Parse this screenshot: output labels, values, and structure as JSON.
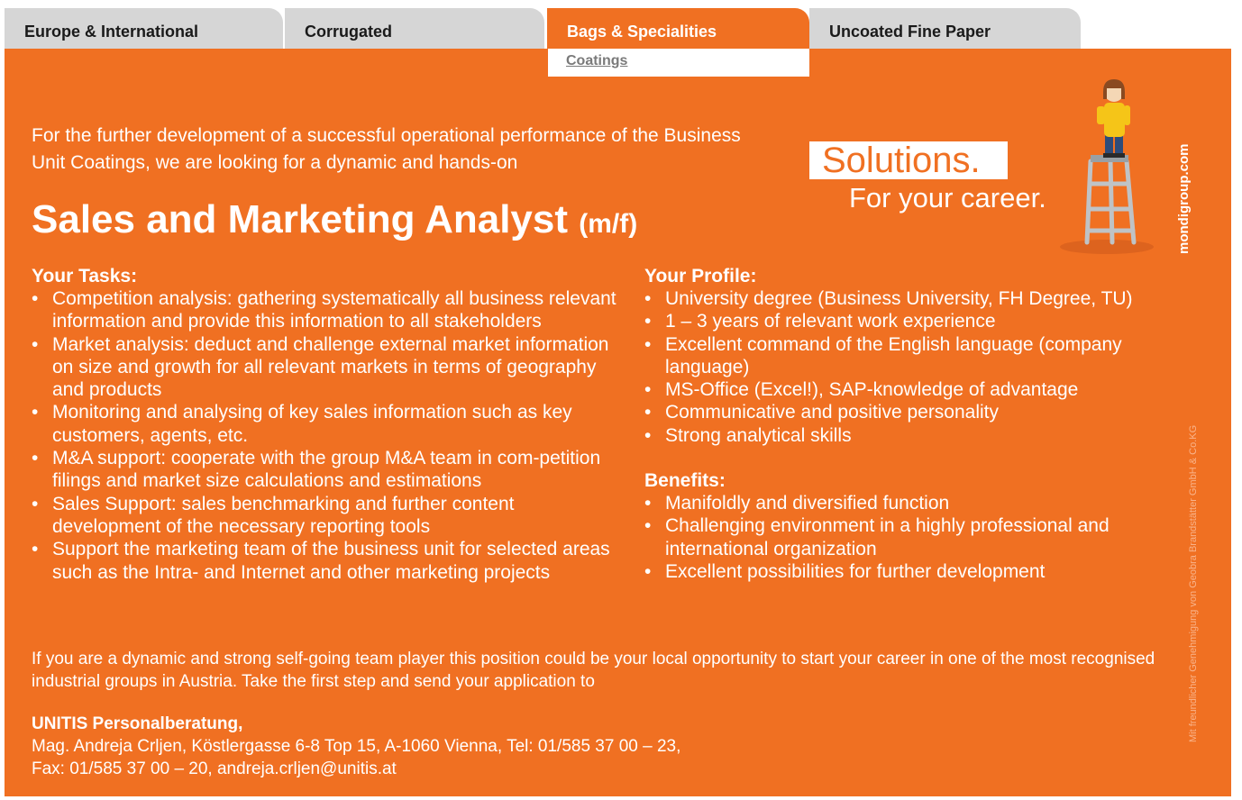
{
  "nav": {
    "tabs": [
      {
        "label": "Europe & International",
        "active": false
      },
      {
        "label": "Corrugated",
        "active": false
      },
      {
        "label": "Bags & Specialities",
        "active": true
      },
      {
        "label": "Uncoated Fine Paper",
        "active": false
      }
    ],
    "subnav": {
      "label": "Coatings"
    }
  },
  "colors": {
    "brand_orange": "#f07022",
    "tab_grey": "#d6d6d6",
    "text_white": "#ffffff"
  },
  "ad": {
    "intro": "For the further development of a successful operational performance of the Business Unit Coatings, we are looking for a dynamic and hands-on",
    "title": "Sales and Marketing Analyst",
    "title_suffix": "(m/f)",
    "brand_word": "Solutions.",
    "tagline": "For your career.",
    "site": "mondigroup.com",
    "photo_credit": "Mit freundlicher Genehmigung von Geobra Brandstätter GmbH & Co.KG",
    "figure_icon": "playmobil-figure-on-ladder-icon",
    "tasks_heading": "Your Tasks:",
    "tasks": [
      "Competition analysis: gathering systematically all business relevant information and provide this information to all stakeholders",
      "Market analysis: deduct and challenge external market information on size and growth for all relevant markets in terms of geography and products",
      "Monitoring and analysing of key sales information such as key customers, agents, etc.",
      "M&A support: cooperate with the group M&A team in com-petition filings and market size calculations and estimations",
      "Sales Support: sales benchmarking and further content development of the necessary reporting tools",
      "Support the marketing team of the business unit for selected areas such as the Intra- and Internet and other marketing projects"
    ],
    "profile_heading": "Your Profile:",
    "profile": [
      "University degree (Business University, FH Degree, TU)",
      "1 – 3 years of relevant work experience",
      "Excellent command of the English language (company language)",
      "MS-Office (Excel!), SAP-knowledge of advantage",
      "Communicative and positive personality",
      "Strong analytical skills"
    ],
    "benefits_heading": "Benefits:",
    "benefits": [
      "Manifoldly and diversified function",
      "Challenging environment in a highly professional and international organization",
      "Excellent possibilities for further development"
    ],
    "closing": "If you are a dynamic and strong self-going team player this position could be your local opportunity to start your career in one of the most recognised industrial groups in Austria. Take the first step and send your application to",
    "contact": {
      "company": "UNITIS Personalberatung,",
      "line1": "Mag. Andreja Crljen, Köstlergasse 6-8 Top 15, A-1060 Vienna, Tel: 01/585 37 00 – 23,",
      "line2": "Fax: 01/585 37 00 – 20, andreja.crljen@unitis.at"
    }
  }
}
